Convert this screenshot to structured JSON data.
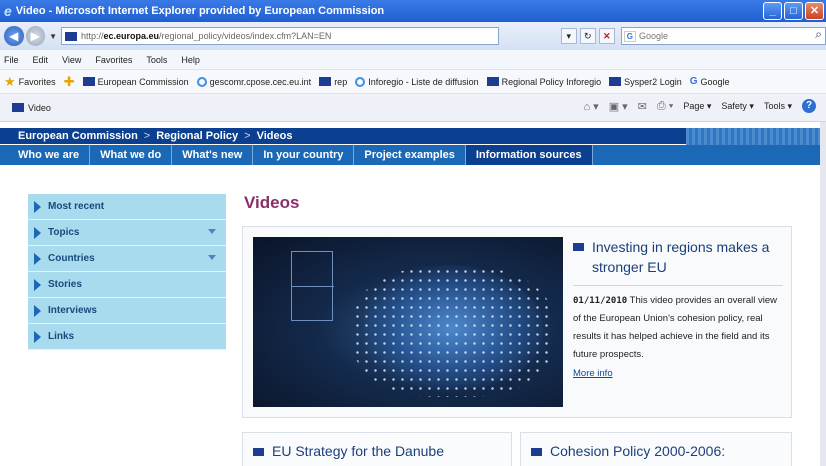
{
  "browser": {
    "title": "Video - Microsoft Internet Explorer provided by European Commission",
    "address_prefix": "http://",
    "address_domain": "ec.europa.eu",
    "address_path": "/regional_policy/videos/index.cfm?LAN=EN",
    "search_placeholder": "Google",
    "menu": [
      "File",
      "Edit",
      "View",
      "Favorites",
      "Tools",
      "Help"
    ],
    "favorites_label": "Favorites",
    "favorites_links": [
      "European Commission",
      "gescomr.cpose.cec.eu.int",
      "rep",
      "Inforegio - Liste de diffusion",
      "Regional Policy Inforegio",
      "Sysper2 Login",
      "Google"
    ],
    "tab_label": "Video",
    "commands": [
      "Page ▾",
      "Safety ▾",
      "Tools ▾"
    ]
  },
  "header": {
    "breadcrumb": [
      "European Commission",
      "Regional Policy",
      "Videos"
    ],
    "nav": [
      "Who we are",
      "What we do",
      "What's new",
      "In your country",
      "Project examples",
      "Information sources"
    ],
    "active_nav": "Information sources"
  },
  "sidebar": {
    "items": [
      {
        "label": "Most recent"
      },
      {
        "label": "Topics"
      },
      {
        "label": "Countries"
      },
      {
        "label": "Stories"
      },
      {
        "label": "Interviews"
      },
      {
        "label": "Links"
      }
    ]
  },
  "main": {
    "title": "Videos",
    "feature": {
      "title": "Investing in regions makes a stronger EU",
      "date": "01/11/2010",
      "description": "This video provides an overall view of the European Union's cohesion policy, real results it has helped achieve in the field and its future prospects.",
      "more_info": "More info"
    },
    "cards": [
      {
        "title": "EU Strategy for the Danube"
      },
      {
        "title": "Cohesion Policy 2000-2006:"
      }
    ]
  },
  "colors": {
    "nav_blue": "#1b68b6",
    "breadcrumb_blue": "#0b3f8f",
    "sidebar_bg": "#a8dbee",
    "title_purple": "#8a2f6a"
  }
}
